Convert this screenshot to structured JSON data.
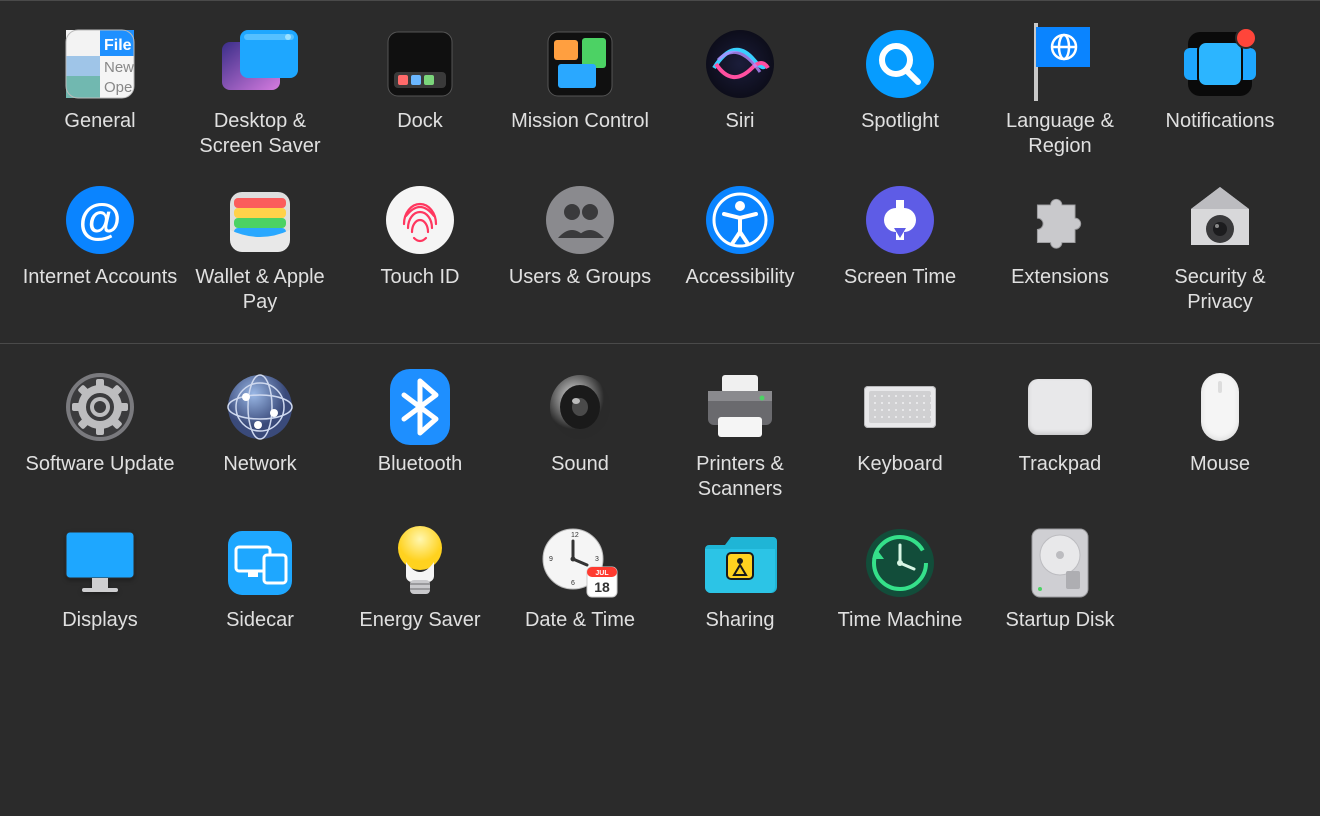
{
  "sections": [
    {
      "items": [
        {
          "id": "general",
          "label": "General"
        },
        {
          "id": "desktop",
          "label": "Desktop & Screen Saver"
        },
        {
          "id": "dock",
          "label": "Dock"
        },
        {
          "id": "mission",
          "label": "Mission Control"
        },
        {
          "id": "siri",
          "label": "Siri"
        },
        {
          "id": "spotlight",
          "label": "Spotlight"
        },
        {
          "id": "language",
          "label": "Language & Region"
        },
        {
          "id": "notifications",
          "label": "Notifications"
        },
        {
          "id": "internet",
          "label": "Internet Accounts"
        },
        {
          "id": "wallet",
          "label": "Wallet & Apple Pay"
        },
        {
          "id": "touchid",
          "label": "Touch ID"
        },
        {
          "id": "users",
          "label": "Users & Groups"
        },
        {
          "id": "accessibility",
          "label": "Accessibility"
        },
        {
          "id": "screentime",
          "label": "Screen Time"
        },
        {
          "id": "extensions",
          "label": "Extensions"
        },
        {
          "id": "security",
          "label": "Security & Privacy"
        }
      ]
    },
    {
      "items": [
        {
          "id": "software",
          "label": "Software Update"
        },
        {
          "id": "network",
          "label": "Network"
        },
        {
          "id": "bluetooth",
          "label": "Bluetooth"
        },
        {
          "id": "sound",
          "label": "Sound"
        },
        {
          "id": "printers",
          "label": "Printers & Scanners"
        },
        {
          "id": "keyboard",
          "label": "Keyboard"
        },
        {
          "id": "trackpad",
          "label": "Trackpad"
        },
        {
          "id": "mouse",
          "label": "Mouse"
        },
        {
          "id": "displays",
          "label": "Displays"
        },
        {
          "id": "sidecar",
          "label": "Sidecar"
        },
        {
          "id": "energy",
          "label": "Energy Saver"
        },
        {
          "id": "datetime",
          "label": "Date & Time"
        },
        {
          "id": "sharing",
          "label": "Sharing"
        },
        {
          "id": "timemachine",
          "label": "Time Machine"
        },
        {
          "id": "startup",
          "label": "Startup Disk"
        }
      ]
    }
  ],
  "icon_text": {
    "general_file": "File",
    "general_new": "New",
    "general_open": "Ope",
    "datetime_month": "JUL",
    "datetime_day": "18"
  }
}
